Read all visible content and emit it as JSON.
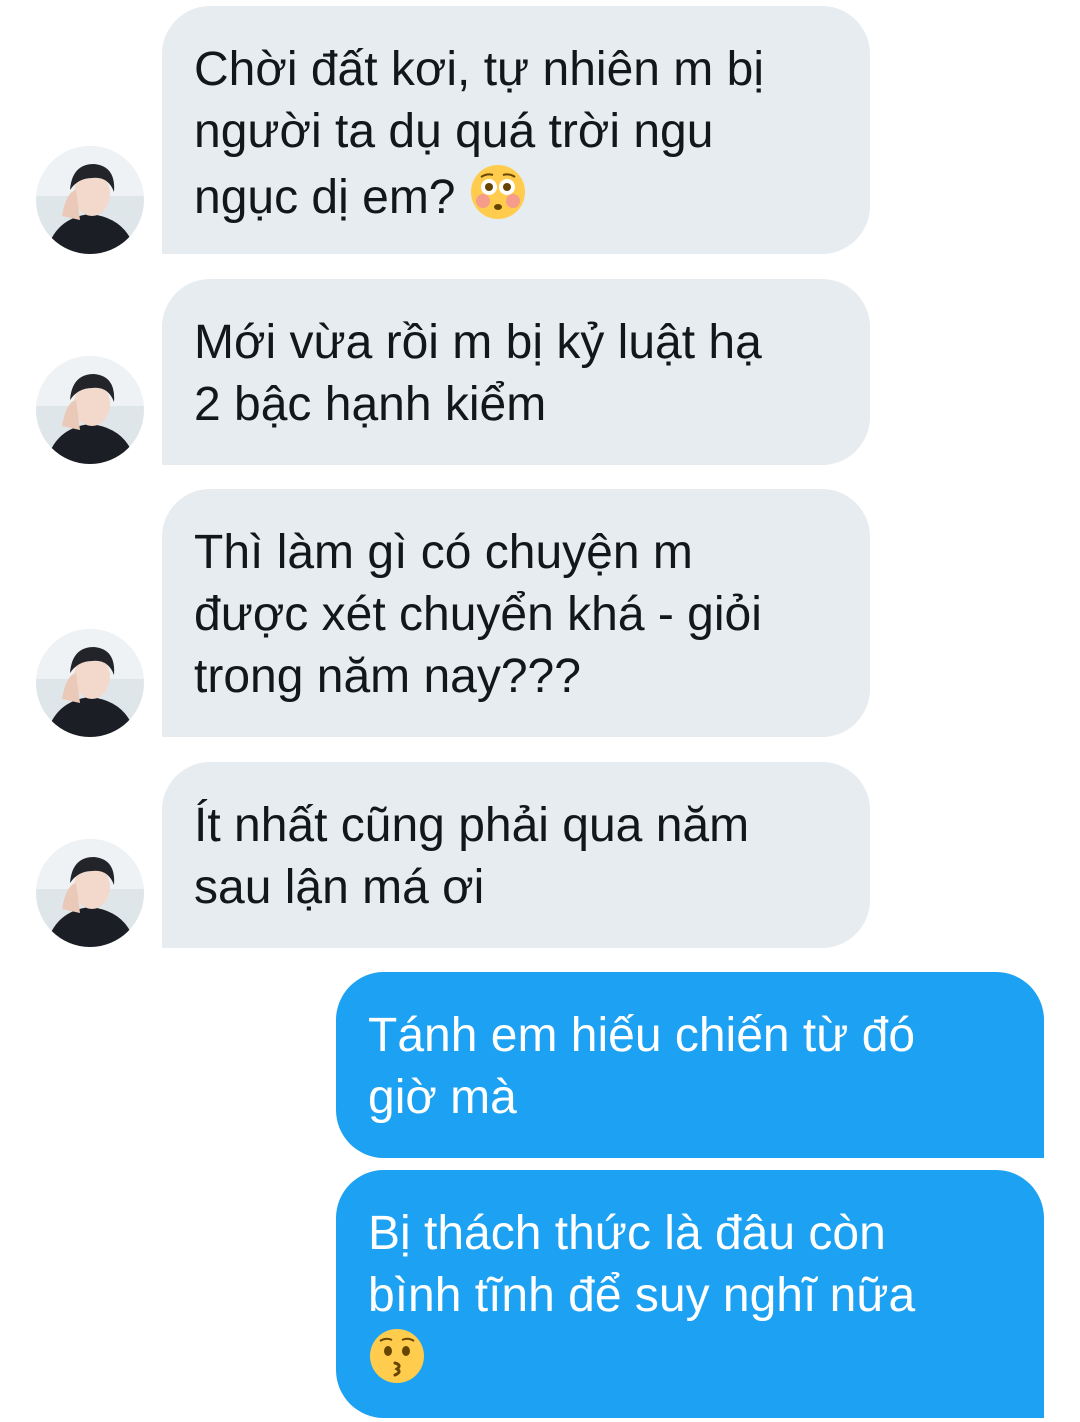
{
  "messages": [
    {
      "from": "other",
      "lines": [
        "Chời đất kơi, tự nhiên m bị",
        "người ta dụ quá trời ngu",
        "ngục dị em?"
      ],
      "emoji": "flushed-face-emoji"
    },
    {
      "from": "other",
      "lines": [
        "Mới vừa rồi m bị kỷ luật hạ",
        "2 bậc hạnh kiểm"
      ]
    },
    {
      "from": "other",
      "lines": [
        "Thì làm gì có chuyện m",
        "được xét chuyển khá - giỏi",
        "trong năm nay???"
      ]
    },
    {
      "from": "other",
      "lines": [
        "Ít nhất cũng phải qua năm",
        "sau lận má ơi"
      ]
    },
    {
      "from": "me",
      "lines": [
        "Tánh em hiếu chiến từ đó",
        "giờ mà"
      ]
    },
    {
      "from": "me",
      "lines": [
        "Bị thách thức là đâu còn",
        "bình tĩnh để suy nghĩ nữa"
      ],
      "emoji": "kissing-face-emoji"
    }
  ],
  "avatar": {
    "icon": "user-avatar-photo"
  },
  "colors": {
    "received_bubble": "#e6ecf0",
    "received_text": "#14171a",
    "sent_bubble": "#1da1f2",
    "sent_text": "#ffffff"
  }
}
